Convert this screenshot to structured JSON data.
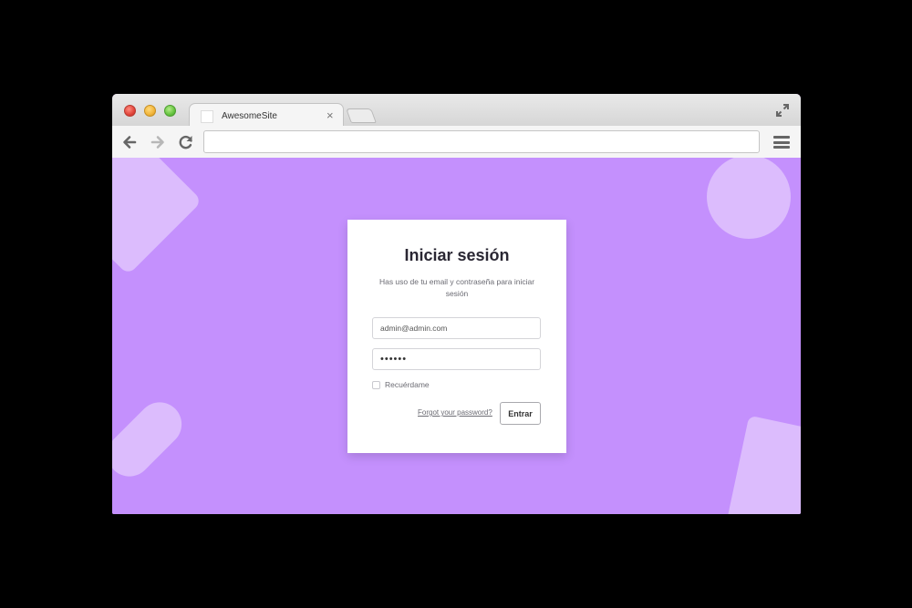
{
  "browser": {
    "tab_title": "AwesomeSite",
    "tab_close": "×",
    "address": ""
  },
  "login": {
    "title": "Iniciar sesión",
    "subtitle": "Has uso de tu email y contraseña para iniciar sesión",
    "email_value": "admin@admin.com",
    "password_value": "••••••",
    "remember_label": "Recuérdame",
    "remember_checked": false,
    "forgot_link": "Forgot your password?",
    "submit_label": "Entrar"
  },
  "colors": {
    "background": "#c490fd",
    "shape": "#dcbcfd",
    "card": "#ffffff"
  },
  "icons": [
    "back-arrow-icon",
    "forward-arrow-icon",
    "reload-icon",
    "menu-icon",
    "expand-icon"
  ]
}
